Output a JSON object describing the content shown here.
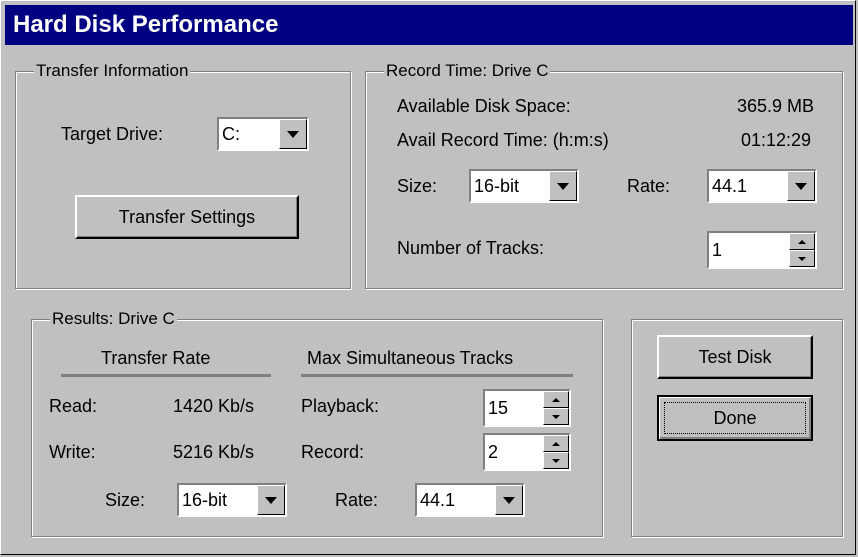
{
  "window": {
    "title": "Hard Disk Performance"
  },
  "transfer": {
    "group_label": "Transfer Information",
    "target_drive_label": "Target Drive:",
    "target_drive_value": "C:",
    "settings_button": "Transfer Settings"
  },
  "record": {
    "group_label": "Record Time: Drive C",
    "available_label": "Available Disk Space:",
    "available_value": "365.9 MB",
    "avail_time_label": "Avail Record Time: (h:m:s)",
    "avail_time_value": "01:12:29",
    "size_label": "Size:",
    "size_value": "16-bit",
    "rate_label": "Rate:",
    "rate_value": "44.1",
    "tracks_label": "Number of Tracks:",
    "tracks_value": "1"
  },
  "results": {
    "group_label": "Results: Drive C",
    "transfer_rate_header": "Transfer Rate",
    "max_tracks_header": "Max Simultaneous Tracks",
    "read_label": "Read:",
    "read_value": "1420 Kb/s",
    "write_label": "Write:",
    "write_value": "5216 Kb/s",
    "playback_label": "Playback:",
    "playback_value": "15",
    "record_label": "Record:",
    "record_value": "2",
    "size_label": "Size:",
    "size_value": "16-bit",
    "rate_label": "Rate:",
    "rate_value": "44.1"
  },
  "actions": {
    "test_disk": "Test Disk",
    "done": "Done"
  },
  "icons": {
    "dropdown": "chevron-down-icon",
    "spin_up": "spin-up-icon",
    "spin_down": "spin-down-icon"
  }
}
